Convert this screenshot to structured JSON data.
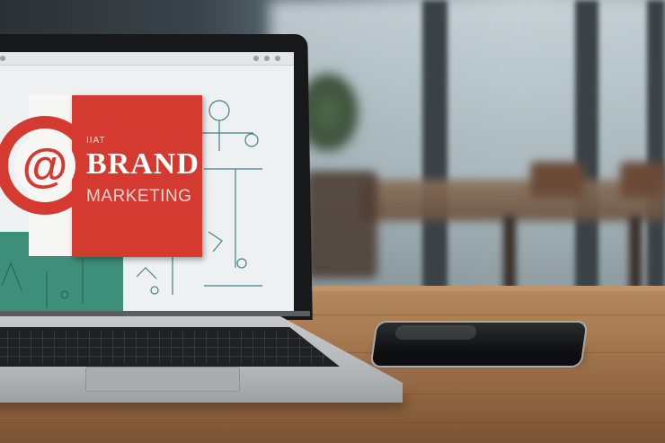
{
  "screen_card": {
    "small_text": "ІІАТ",
    "headline": "BRAND",
    "subhead": "MARKETING"
  },
  "colors": {
    "brand_red": "#d43a2f",
    "teal_panel": "#3d8f79",
    "desk_wood": "#a87b52"
  },
  "icons": {
    "logo": "at-sign-icon"
  }
}
